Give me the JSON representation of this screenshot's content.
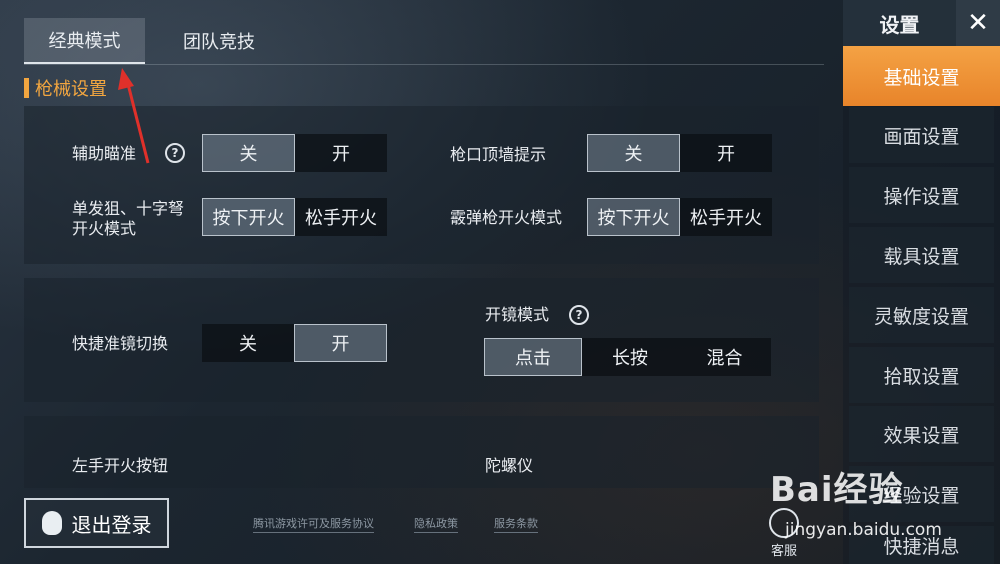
{
  "tabs": [
    {
      "label": "经典模式",
      "active": true
    },
    {
      "label": "团队竞技",
      "active": false
    }
  ],
  "section": {
    "title": "枪械设置"
  },
  "settings": {
    "aim_assist": {
      "label": "辅助瞄准",
      "options": [
        "关",
        "开"
      ],
      "selected": "关"
    },
    "muzzle_hint": {
      "label": "枪口顶墙提示",
      "options": [
        "关",
        "开"
      ],
      "selected": "关"
    },
    "sniper_fire": {
      "label_line1": "单发狙、十字弩",
      "label_line2": "开火模式",
      "options": [
        "按下开火",
        "松手开火"
      ],
      "selected": "按下开火"
    },
    "shotgun_fire": {
      "label": "霰弹枪开火模式",
      "options": [
        "按下开火",
        "松手开火"
      ],
      "selected": "按下开火"
    },
    "quick_scope": {
      "label": "快捷准镜切换",
      "options": [
        "关",
        "开"
      ],
      "selected": "开"
    },
    "scope_mode": {
      "label": "开镜模式",
      "options": [
        "点击",
        "长按",
        "混合"
      ],
      "selected": "点击"
    },
    "left_fire": {
      "label": "左手开火按钮"
    },
    "gyro": {
      "label": "陀螺仪"
    }
  },
  "sidebar": {
    "title": "设置",
    "close": "✕",
    "items": [
      {
        "label": "基础设置",
        "active": true
      },
      {
        "label": "画面设置"
      },
      {
        "label": "操作设置"
      },
      {
        "label": "载具设置"
      },
      {
        "label": "灵敏度设置"
      },
      {
        "label": "拾取设置"
      },
      {
        "label": "效果设置"
      },
      {
        "label": "经验设置"
      },
      {
        "label": "快捷消息"
      }
    ]
  },
  "footer": {
    "logout": "退出登录",
    "links": [
      "腾讯游戏许可及服务协议",
      "隐私政策",
      "服务条款"
    ],
    "kefu": "客服"
  },
  "watermark": {
    "line1": "Bai经验",
    "line2": "jingyan.baidu.com"
  },
  "colors": {
    "accent": "#f2a640",
    "sidebar_active": "#f0962e"
  }
}
